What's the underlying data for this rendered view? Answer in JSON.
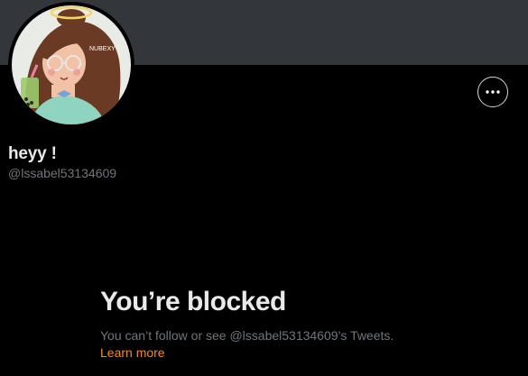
{
  "profile": {
    "display_name": "heyy !",
    "handle": "@lssabel53134609",
    "avatar_watermark": "NUBEXY"
  },
  "actions": {
    "more_icon": "more-horizontal-icon"
  },
  "blocked": {
    "title": "You’re blocked",
    "message": "You can’t follow or see @lssabel53134609’s Tweets.",
    "learn_more": "Learn more"
  },
  "colors": {
    "banner": "#33373b",
    "background": "#000000",
    "accent_link": "#f58a1f",
    "secondary_text": "#71767b"
  }
}
